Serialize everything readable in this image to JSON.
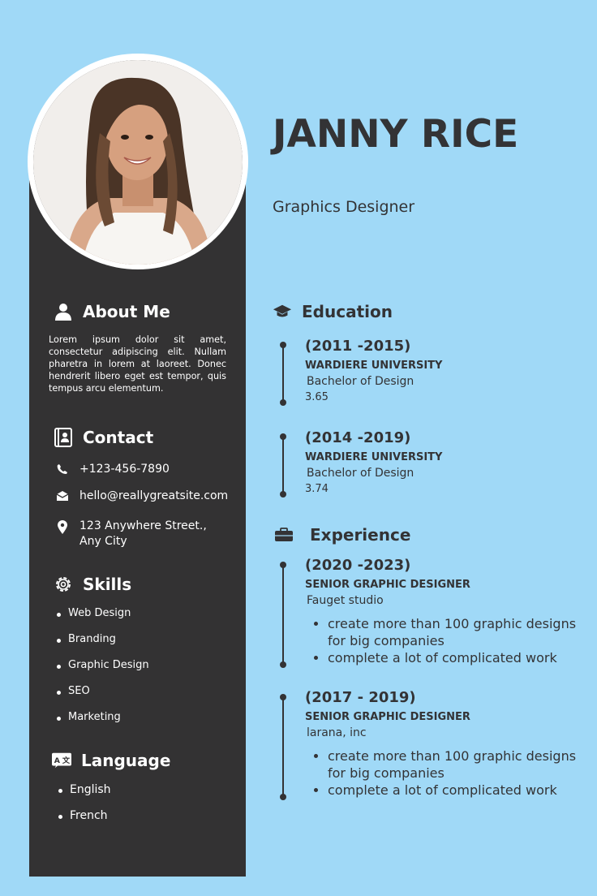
{
  "name": "JANNY RICE",
  "role": "Graphics Designer",
  "about": {
    "heading": "About Me",
    "text": "Lorem ipsum dolor sit amet, consectetur adipiscing elit. Nullam pharetra in lorem at laoreet. Donec hendrerit libero eget est tempor, quis tempus arcu elementum."
  },
  "contact": {
    "heading": "Contact",
    "phone": "+123-456-7890",
    "email": "hello@reallygreatsite.com",
    "address": "123 Anywhere Street., Any City"
  },
  "skills": {
    "heading": "Skills",
    "items": [
      "Web Design",
      "Branding",
      "Graphic Design",
      "SEO",
      "Marketing"
    ]
  },
  "language": {
    "heading": "Language",
    "items": [
      "English",
      "French"
    ]
  },
  "education": {
    "heading": "Education",
    "entries": [
      {
        "years": "(2011 -2015)",
        "school": "WARDIERE UNIVERSITY",
        "degree": "Bachelor of Design",
        "gpa": "3.65"
      },
      {
        "years": "(2014 -2019)",
        "school": "WARDIERE UNIVERSITY",
        "degree": "Bachelor of Design",
        "gpa": "3.74"
      }
    ]
  },
  "experience": {
    "heading": "Experience",
    "entries": [
      {
        "years": "(2020 -2023)",
        "title": "SENIOR GRAPHIC DESIGNER",
        "company": "Fauget studio",
        "bullets": [
          "create more than 100 graphic designs for big companies",
          "complete a lot of complicated work"
        ]
      },
      {
        "years": "(2017 - 2019)",
        "title": "SENIOR GRAPHIC DESIGNER",
        "company": "larana, inc",
        "bullets": [
          "create more than 100 graphic designs for big companies",
          "complete a lot of complicated work"
        ]
      }
    ]
  },
  "icons": {
    "about": "person-icon",
    "contact": "contact-card-icon",
    "phone": "phone-icon",
    "email": "envelope-icon",
    "address": "map-pin-icon",
    "skills": "gear-icon",
    "language": "translate-icon",
    "education": "graduation-cap-icon",
    "experience": "briefcase-icon"
  },
  "colors": {
    "background": "#a0d9f7",
    "sidebar": "#333233",
    "text": "#333335",
    "accent": "#ffffff"
  }
}
